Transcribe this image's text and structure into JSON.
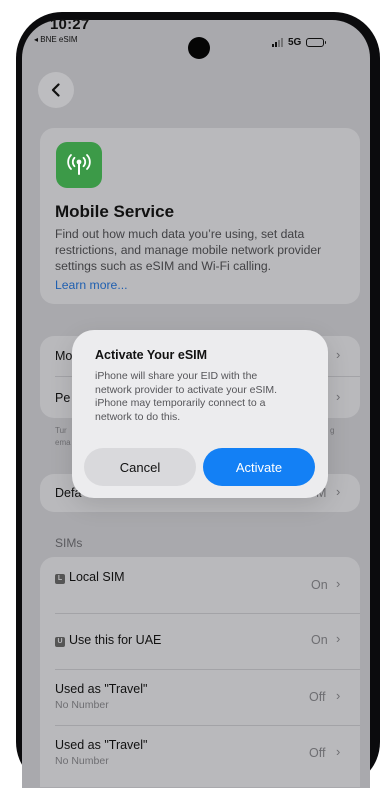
{
  "status_bar": {
    "time": "10:27",
    "carrier": "◂ BNE eSIM",
    "network": "5G"
  },
  "service": {
    "title": "Mobile Service",
    "description": "Find out how much data you’re using, set data restrictions, and manage mobile network provider settings such as eSIM and Wi-Fi calling.",
    "learn_more": "Learn more...",
    "icon_color": "#3c9a48"
  },
  "background_rows": {
    "row1_label": "Mo",
    "row2_label": "Pe",
    "footnote_line1": "Tur",
    "footnote_line2": "ema",
    "footnote_end": "g",
    "default_row_label": "Defa",
    "default_row_value": "M"
  },
  "sims": {
    "header": "SIMs",
    "items": [
      {
        "badge": "L",
        "label": "Local SIM",
        "subtitle": "",
        "value": "On"
      },
      {
        "badge": "U",
        "label": "Use this for UAE",
        "subtitle": "",
        "value": "On"
      },
      {
        "badge": "",
        "label": "Used as \"Travel\"",
        "subtitle": "No Number",
        "value": "Off"
      },
      {
        "badge": "",
        "label": "Used as \"Travel\"",
        "subtitle": "No Number",
        "value": "Off"
      }
    ]
  },
  "dialog": {
    "title": "Activate Your eSIM",
    "message": "iPhone will share your EID with the network provider to activate your eSIM. iPhone may temporarily connect to a network to do this.",
    "cancel_label": "Cancel",
    "activate_label": "Activate",
    "accent": "#1380f5"
  }
}
